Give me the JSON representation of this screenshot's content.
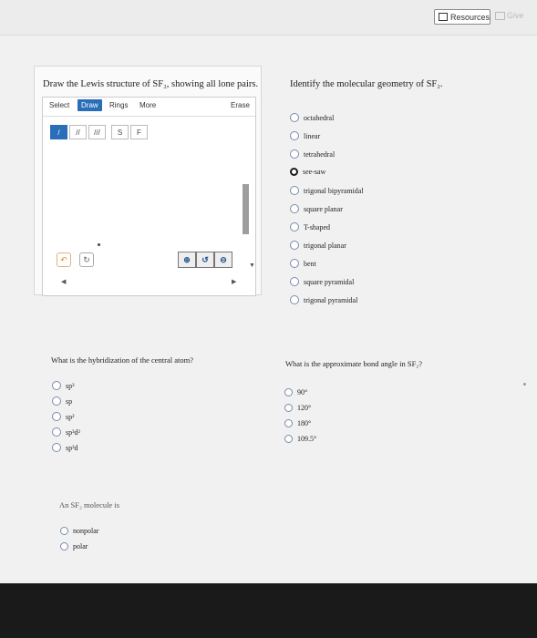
{
  "header": {
    "resources_label": "Resources",
    "give_label": "Give"
  },
  "q1": {
    "prompt": "Draw the Lewis structure of SF₂, showing all lone pairs.",
    "toolbar": {
      "select": "Select",
      "draw": "Draw",
      "rings": "Rings",
      "more": "More",
      "erase": "Erase"
    },
    "bond_tools": [
      "/",
      "//",
      "///"
    ],
    "atom_tools": [
      "S",
      "F"
    ]
  },
  "q2": {
    "prompt": "Identify the molecular geometry of SF₂.",
    "options": [
      "octahedral",
      "linear",
      "tetrahedral",
      "see-saw",
      "trigonal bipyramidal",
      "square planar",
      "T-shaped",
      "trigonal planar",
      "bent",
      "square pyramidal",
      "trigonal pyramidal"
    ],
    "selected": "see-saw"
  },
  "q3": {
    "prompt": "What is the hybridization of the central atom?",
    "options": [
      "sp³",
      "sp",
      "sp²",
      "sp³d²",
      "sp³d"
    ]
  },
  "q4": {
    "prompt": "What is the approximate bond angle in SF₂?",
    "options": [
      "90°",
      "120°",
      "180°",
      "109.5°"
    ]
  },
  "q5": {
    "prompt": "An SF₂ molecule is",
    "options": [
      "nonpolar",
      "polar"
    ]
  }
}
